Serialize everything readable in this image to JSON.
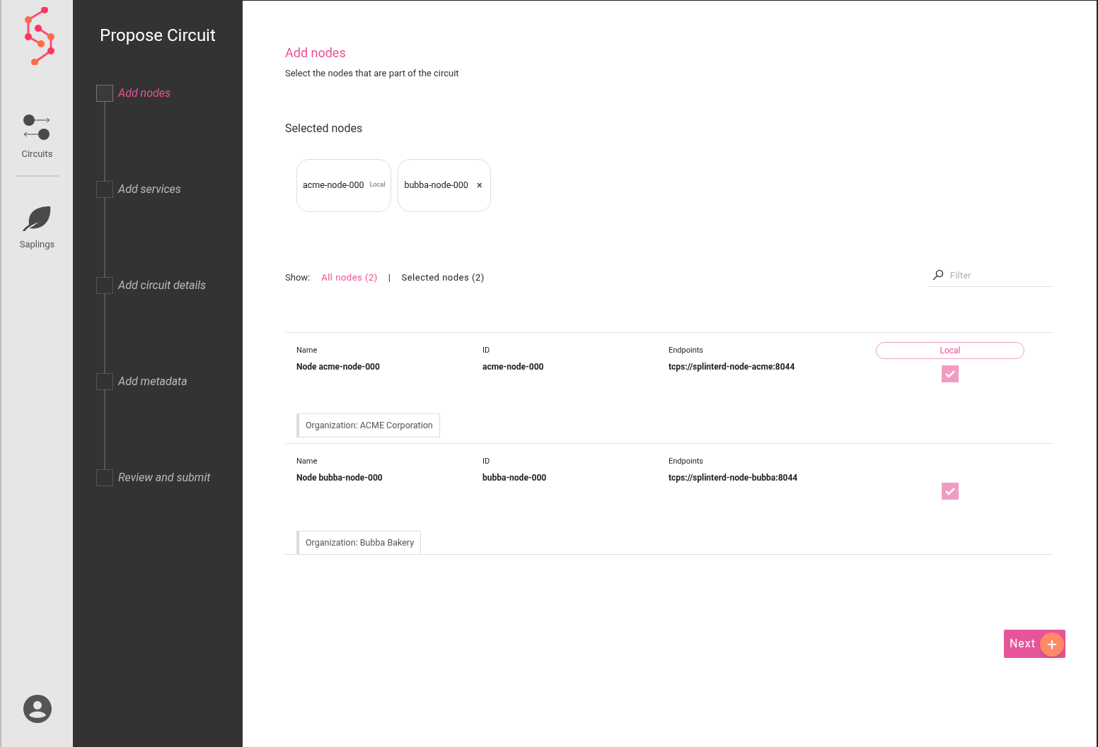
{
  "rail": {
    "items": [
      {
        "kind": "circuits",
        "label": "Circuits"
      },
      {
        "kind": "saplings",
        "label": "Saplings"
      }
    ]
  },
  "stepper": {
    "title": "Propose Circuit",
    "steps": [
      {
        "label": "Add nodes",
        "selected": true
      },
      {
        "label": "Add services",
        "selected": false
      },
      {
        "label": "Add circuit details",
        "selected": false
      },
      {
        "label": "Add metadata",
        "selected": false
      },
      {
        "label": "Review and submit",
        "selected": false
      }
    ]
  },
  "header": {
    "title": "Add nodes",
    "subtitle": "Select the nodes that are part of the circuit"
  },
  "selected_nodes": {
    "title": "Selected nodes",
    "chips": [
      {
        "label": "acme-node-000",
        "kind": "local",
        "tag": "Local"
      },
      {
        "label": "bubba-node-000",
        "kind": "removable",
        "tag": "×"
      }
    ]
  },
  "filter_bar": {
    "show_label": "Show:",
    "options": [
      {
        "label": "All nodes (2)",
        "selected": true
      },
      {
        "label": "Selected nodes (2)",
        "selected": false
      }
    ],
    "separator": "|",
    "search": {
      "placeholder": "Filter"
    }
  },
  "nodes": [
    {
      "name_label": "Name",
      "name": "Node acme-node-000",
      "id_label": "ID",
      "id": "acme-node-000",
      "endpoints_label": "Endpoints",
      "endpoint": "tcps://splinterd-node-acme:8044",
      "badge": "Local",
      "checked": true,
      "organization": "Organization: ACME Corporation"
    },
    {
      "name_label": "Name",
      "name": "Node bubba-node-000",
      "id_label": "ID",
      "id": "bubba-node-000",
      "endpoints_label": "Endpoints",
      "endpoint": "tcps://splinterd-node-bubba:8044",
      "checked": true,
      "organization": "Organization: Bubba Bakery"
    }
  ],
  "next_button": {
    "label": "Next",
    "icon": "+"
  }
}
